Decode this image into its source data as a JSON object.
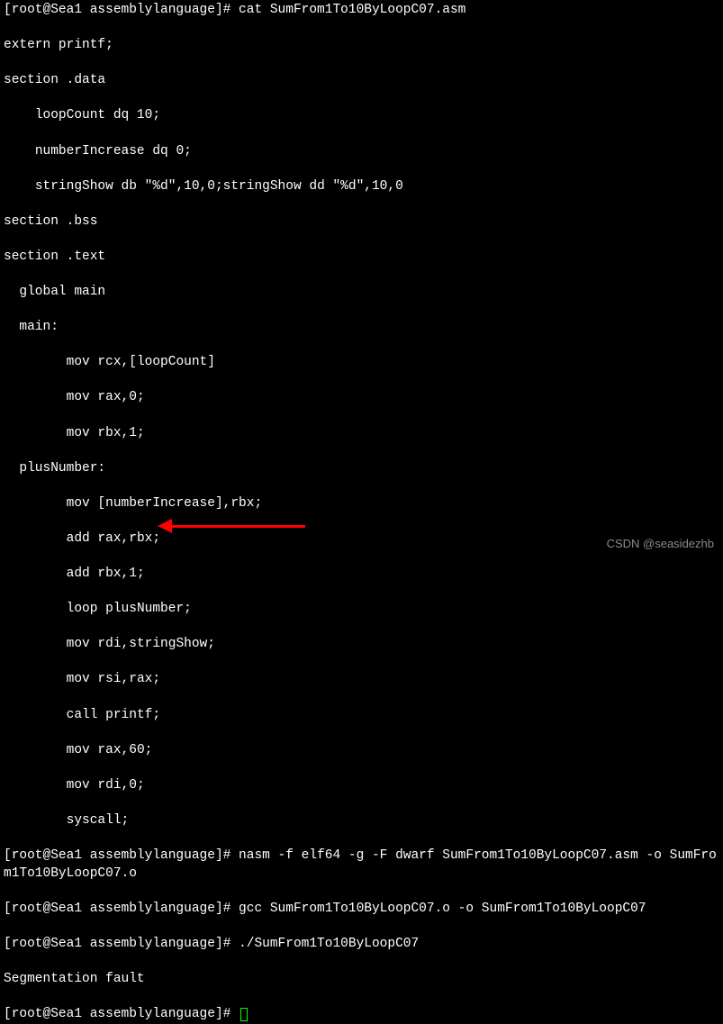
{
  "prompt1": "[root@Sea1 assemblylanguage]# cat SumFrom1To10ByLoopC07.asm",
  "code": {
    "l01": "extern printf;",
    "l02": "section .data",
    "l03": "    loopCount dq 10;",
    "l04": "    numberIncrease dq 0;",
    "l05": "    stringShow db \"%d\",10,0;stringShow dd \"%d\",10,0",
    "l06": "section .bss",
    "l07": "section .text",
    "l08": "  global main",
    "l09": "  main:",
    "l10": "        mov rcx,[loopCount]",
    "l11": "        mov rax,0;",
    "l12": "        mov rbx,1;",
    "l13": "  plusNumber:",
    "l14": "        mov [numberIncrease],rbx;",
    "l15": "        add rax,rbx;",
    "l16": "        add rbx,1;",
    "l17": "        loop plusNumber;",
    "l18": "        mov rdi,stringShow;",
    "l19": "        mov rsi,rax;",
    "l20": "        call printf;",
    "l21": "        mov rax,60;",
    "l22": "        mov rdi,0;",
    "l23": "        syscall;"
  },
  "prompt2": "[root@Sea1 assemblylanguage]# nasm -f elf64 -g -F dwarf SumFrom1To10ByLoopC07.asm -o SumFrom1To10ByLoopC07.o",
  "prompt3": "[root@Sea1 assemblylanguage]# gcc SumFrom1To10ByLoopC07.o -o SumFrom1To10ByLoopC07",
  "prompt4": "[root@Sea1 assemblylanguage]# ./SumFrom1To10ByLoopC07",
  "segfault": "Segmentation fault",
  "prompt5": "[root@Sea1 assemblylanguage]# ",
  "watermark": "CSDN @seasidezhb"
}
